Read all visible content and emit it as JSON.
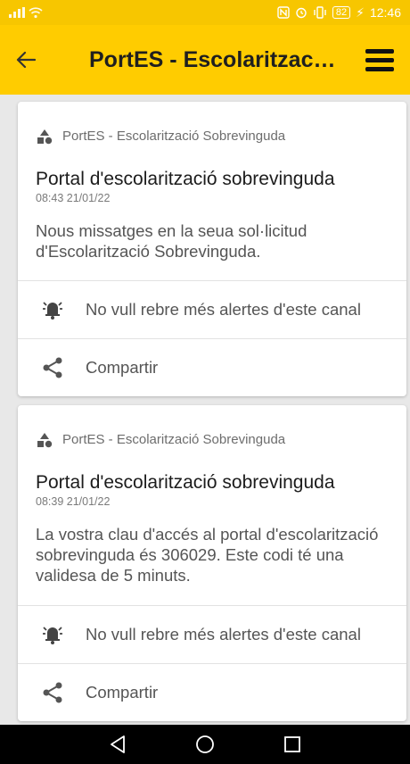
{
  "status_bar": {
    "time": "12:46",
    "battery": "82",
    "icons": [
      "signal-icon",
      "wifi-icon",
      "nfc-icon",
      "alarm-icon",
      "vibrate-icon",
      "battery-icon",
      "charging-icon"
    ]
  },
  "app_bar": {
    "title": "PortES - Escolarització...",
    "icons": [
      "back-arrow-icon",
      "hamburger-menu-icon"
    ]
  },
  "notifications": [
    {
      "source": "PortES - Escolarització Sobrevinguda",
      "title": "Portal d'escolarització sobrevinguda",
      "timestamp": "08:43 21/01/22",
      "body": "Nous missatges en la seua sol·licitud d'Escolarització Sobrevinguda.",
      "actions": {
        "mute": "No vull rebre més alertes d'este canal",
        "share": "Compartir"
      }
    },
    {
      "source": "PortES - Escolarització Sobrevinguda",
      "title": "Portal d'escolarització sobrevinguda",
      "timestamp": "08:39 21/01/22",
      "body": "La vostra clau d'accés al portal d'escolarització sobrevinguda és 306029. Este codi té una validesa de 5 minuts.",
      "actions": {
        "mute": "No vull rebre més alertes d'este canal",
        "share": "Compartir"
      }
    }
  ],
  "nav_bar": {
    "icons": [
      "back-triangle-icon",
      "home-circle-icon",
      "recents-square-icon"
    ]
  },
  "colors": {
    "accent": "#ffcc00",
    "status_bar": "#f7c600",
    "text_primary": "#1c1c1c",
    "text_secondary": "#555555"
  }
}
